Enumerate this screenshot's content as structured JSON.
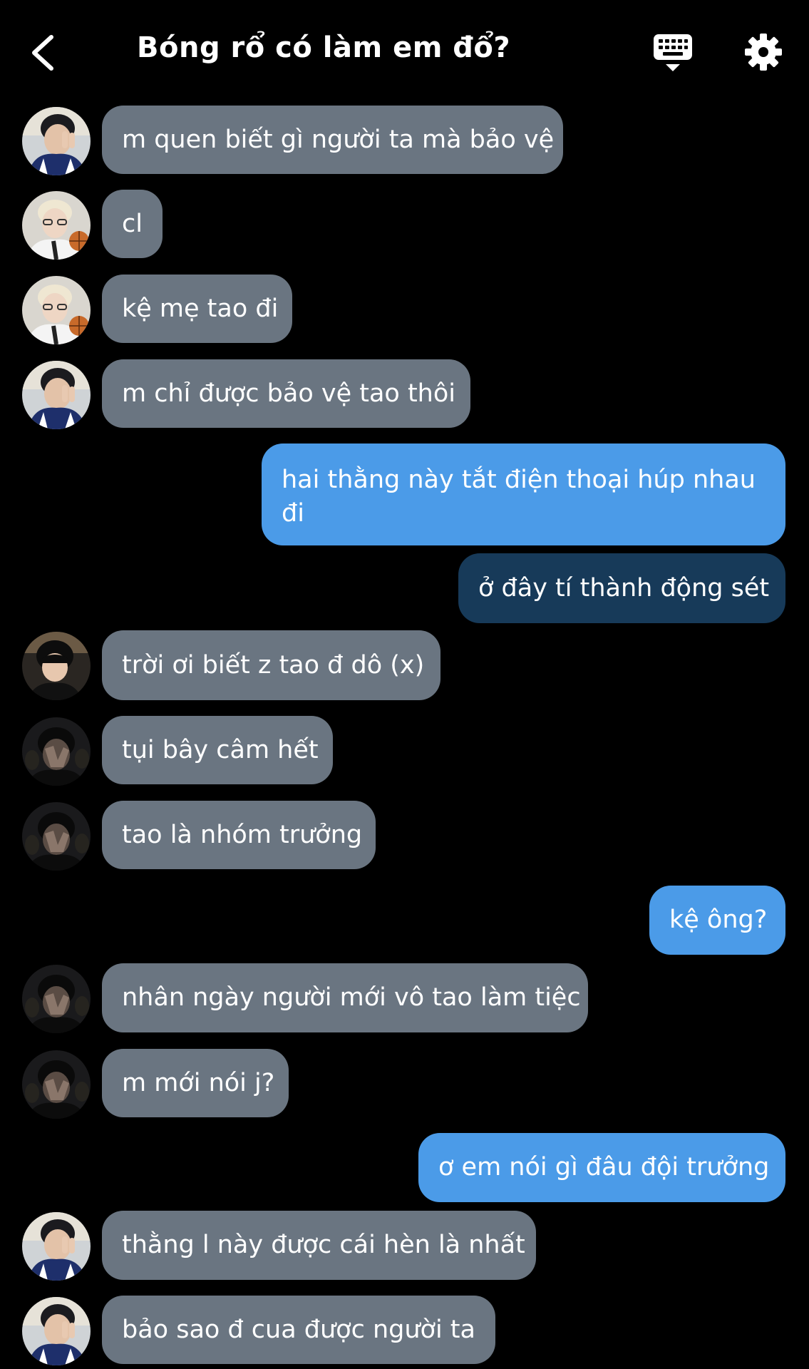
{
  "header": {
    "title": "Bóng rổ có làm em đổ?",
    "back_icon": "chevron-left-icon",
    "keyboard_icon": "keyboard-icon",
    "settings_icon": "gear-icon"
  },
  "colors": {
    "background": "#000000",
    "incoming_bubble": "#6a7581",
    "outgoing_bubble": "#4b9be8",
    "outgoing_bubble_dark": "#173a59"
  },
  "messages": [
    {
      "side": "in",
      "avatar": "avatar-boy-peace",
      "text": "m quen biết gì người ta mà bảo vệ"
    },
    {
      "side": "in",
      "avatar": "avatar-blond-basketball",
      "text": "cl"
    },
    {
      "side": "in",
      "avatar": "avatar-blond-basketball",
      "text": "kệ mẹ tao đi"
    },
    {
      "side": "in",
      "avatar": "avatar-boy-peace",
      "text": "m chỉ được bảo vệ tao thôi"
    },
    {
      "side": "out",
      "text": "hai thằng này tắt điện thoại húp nhau đi"
    },
    {
      "side": "out",
      "style": "dark",
      "text": "ở đây tí thành động sét"
    },
    {
      "side": "in",
      "avatar": "avatar-black-hair",
      "text": "trời ơi biết z tao đ dô (x)"
    },
    {
      "side": "in",
      "avatar": "avatar-dark-hand",
      "text": "tụi bây câm hết"
    },
    {
      "side": "in",
      "avatar": "avatar-dark-hand",
      "text": "tao là nhóm trưởng"
    },
    {
      "side": "out",
      "text": "kệ ông?"
    },
    {
      "side": "in",
      "avatar": "avatar-dark-hand",
      "text": "nhân ngày người mới vô tao làm tiệc"
    },
    {
      "side": "in",
      "avatar": "avatar-dark-hand",
      "text": "m mới nói j?"
    },
    {
      "side": "out",
      "text": "ơ em nói gì đâu đội trưởng"
    },
    {
      "side": "in",
      "avatar": "avatar-boy-peace",
      "text": "thằng l này được cái hèn là nhất"
    },
    {
      "side": "in",
      "avatar": "avatar-boy-peace",
      "text": "bảo sao đ cua được người ta"
    }
  ]
}
